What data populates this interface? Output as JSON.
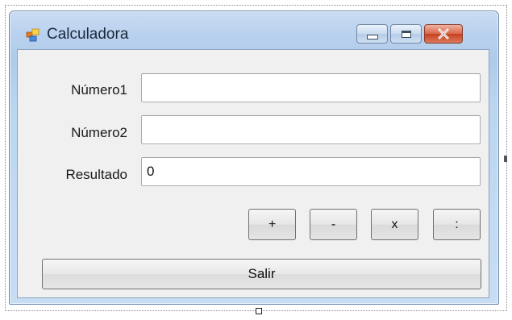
{
  "window": {
    "title": "Calculadora",
    "icon": "windows-forms-app-icon"
  },
  "caption_buttons": {
    "minimize_icon": "minimize-icon",
    "maximize_icon": "maximize-icon",
    "close_icon": "close-icon"
  },
  "form": {
    "numero1": {
      "label": "Número1",
      "value": ""
    },
    "numero2": {
      "label": "Número2",
      "value": ""
    },
    "resultado": {
      "label": "Resultado",
      "value": "0"
    }
  },
  "operations": {
    "add_label": "+",
    "subtract_label": "-",
    "multiply_label": "x",
    "divide_label": ":"
  },
  "exit_label": "Salir",
  "colors": {
    "window_frame": "#b9d1ee",
    "client_background": "#f0f0f0",
    "close_button": "#c4401f"
  }
}
